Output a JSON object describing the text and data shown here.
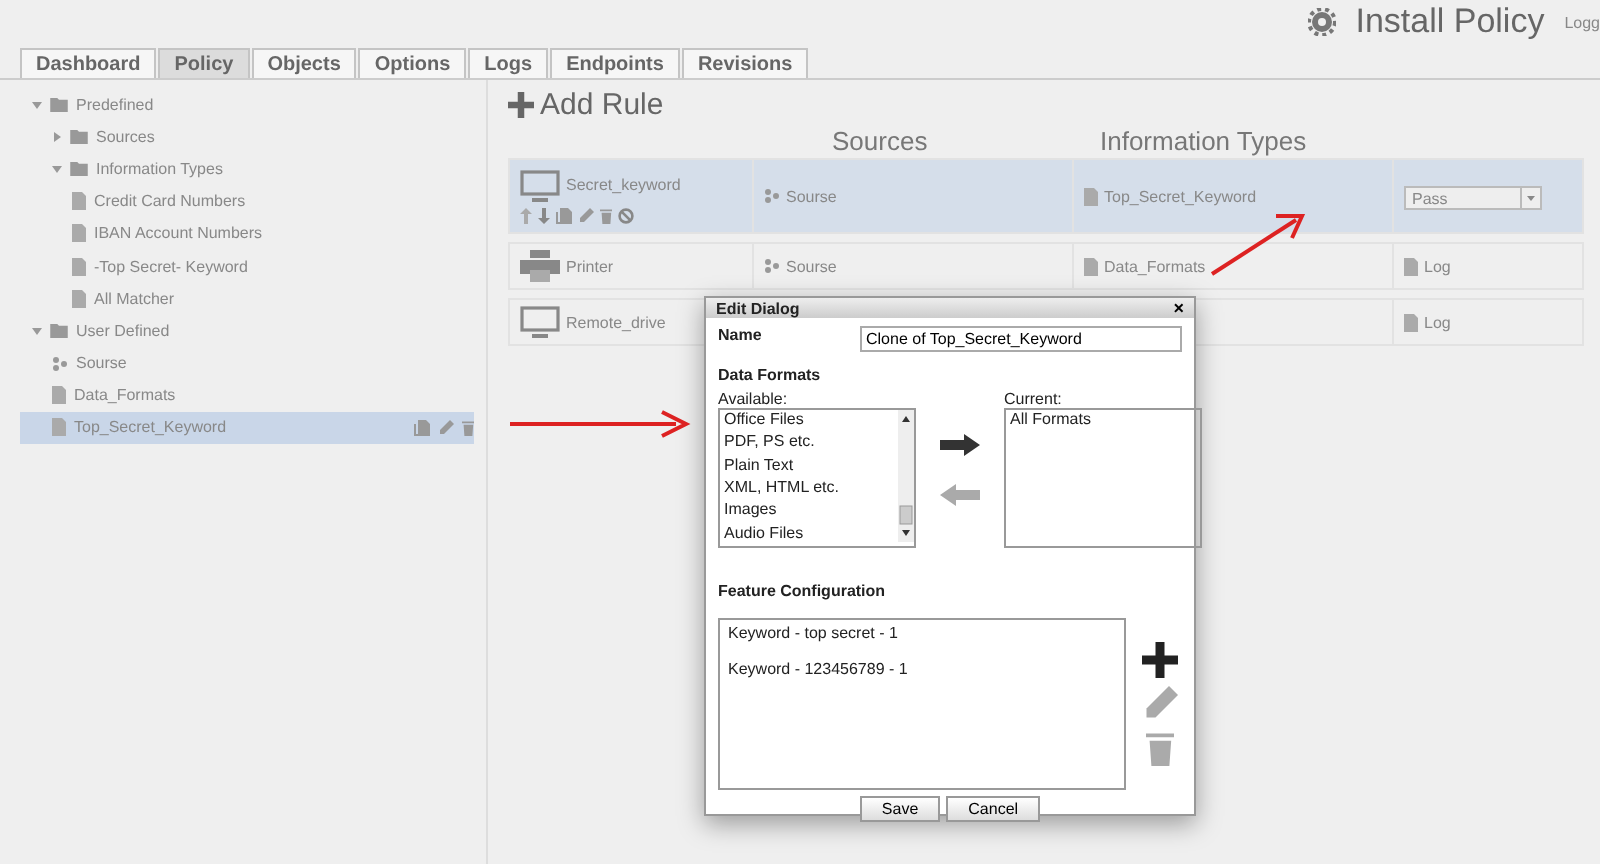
{
  "header": {
    "title": "Install Policy",
    "user_link": "Logg"
  },
  "tabs": [
    {
      "label": "Dashboard",
      "selected": false
    },
    {
      "label": "Policy",
      "selected": true
    },
    {
      "label": "Objects",
      "selected": false
    },
    {
      "label": "Options",
      "selected": false
    },
    {
      "label": "Logs",
      "selected": false
    },
    {
      "label": "Endpoints",
      "selected": false
    },
    {
      "label": "Revisions",
      "selected": false
    }
  ],
  "tree": [
    {
      "label": "Predefined",
      "kind": "folder",
      "expanded": true,
      "selected": false,
      "children": [
        {
          "label": "Sources",
          "kind": "folder",
          "expanded": false,
          "selected": false
        },
        {
          "label": "Information Types",
          "kind": "folder",
          "expanded": true,
          "selected": false,
          "children": [
            {
              "label": "Credit Card Numbers",
              "kind": "file",
              "selected": false
            },
            {
              "label": "IBAN Account Numbers",
              "kind": "file",
              "selected": false
            },
            {
              "label": "-Top Secret- Keyword",
              "kind": "file",
              "selected": false
            },
            {
              "label": "All Matcher",
              "kind": "file",
              "selected": false
            }
          ]
        }
      ]
    },
    {
      "label": "User Defined",
      "kind": "folder",
      "expanded": true,
      "selected": false,
      "children": [
        {
          "label": "Sourse",
          "kind": "source",
          "selected": false
        },
        {
          "label": "Data_Formats",
          "kind": "file",
          "selected": false
        },
        {
          "label": "Top_Secret_Keyword",
          "kind": "file",
          "selected": true
        }
      ]
    }
  ],
  "rules": {
    "add_label": "Add Rule",
    "columns": [
      "Sources",
      "Information Types"
    ],
    "rows": [
      {
        "name": "Secret_keyword",
        "kind": "monitor",
        "selected": true,
        "source": "Sourse",
        "info_type": "Top_Secret_Keyword",
        "action": {
          "text": "Pass",
          "kind": "dropdown"
        }
      },
      {
        "name": "Printer",
        "kind": "printer",
        "selected": false,
        "source": "Sourse",
        "info_type": "Data_Formats",
        "action": {
          "text": "Log",
          "kind": "log"
        }
      },
      {
        "name": "Remote_drive",
        "kind": "monitor",
        "selected": false,
        "action": {
          "text": "Log",
          "kind": "log"
        }
      }
    ]
  },
  "dialog": {
    "title": "Edit Dialog",
    "close": "×",
    "name_label": "Name",
    "name_value": "Clone of Top_Secret_Keyword",
    "formats_label": "Data Formats",
    "available_label": "Available:",
    "available": [
      "Office Files",
      "PDF, PS etc.",
      "Plain Text",
      "XML, HTML etc.",
      "Images",
      "Audio Files"
    ],
    "current_label": "Current:",
    "current": [
      "All Formats"
    ],
    "feature_label": "Feature Configuration",
    "features": [
      "Keyword - top secret - 1",
      "Keyword - 123456789 - 1"
    ],
    "buttons": [
      "Save",
      "Cancel"
    ]
  }
}
